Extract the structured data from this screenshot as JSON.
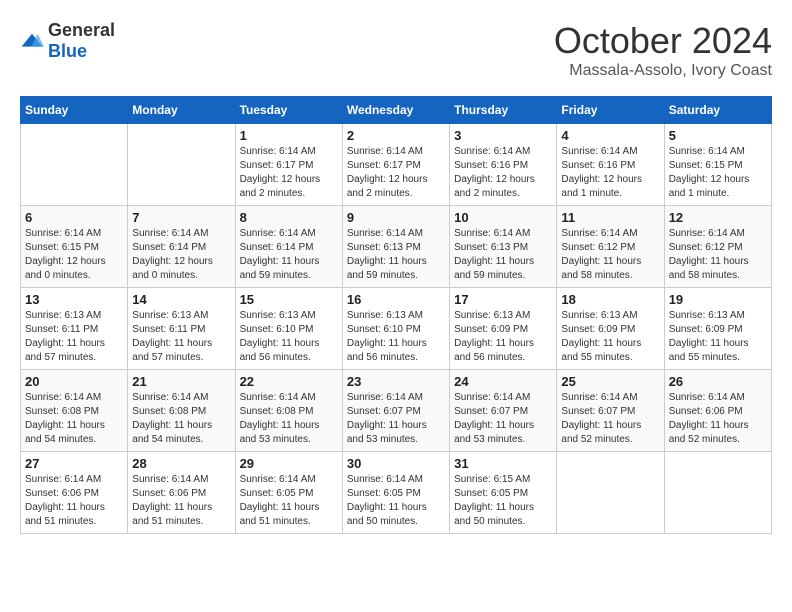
{
  "header": {
    "logo_general": "General",
    "logo_blue": "Blue",
    "month_title": "October 2024",
    "location": "Massala-Assolo, Ivory Coast"
  },
  "days_of_week": [
    "Sunday",
    "Monday",
    "Tuesday",
    "Wednesday",
    "Thursday",
    "Friday",
    "Saturday"
  ],
  "weeks": [
    [
      {
        "day": "",
        "info": ""
      },
      {
        "day": "",
        "info": ""
      },
      {
        "day": "1",
        "info": "Sunrise: 6:14 AM\nSunset: 6:17 PM\nDaylight: 12 hours\nand 2 minutes."
      },
      {
        "day": "2",
        "info": "Sunrise: 6:14 AM\nSunset: 6:17 PM\nDaylight: 12 hours\nand 2 minutes."
      },
      {
        "day": "3",
        "info": "Sunrise: 6:14 AM\nSunset: 6:16 PM\nDaylight: 12 hours\nand 2 minutes."
      },
      {
        "day": "4",
        "info": "Sunrise: 6:14 AM\nSunset: 6:16 PM\nDaylight: 12 hours\nand 1 minute."
      },
      {
        "day": "5",
        "info": "Sunrise: 6:14 AM\nSunset: 6:15 PM\nDaylight: 12 hours\nand 1 minute."
      }
    ],
    [
      {
        "day": "6",
        "info": "Sunrise: 6:14 AM\nSunset: 6:15 PM\nDaylight: 12 hours\nand 0 minutes."
      },
      {
        "day": "7",
        "info": "Sunrise: 6:14 AM\nSunset: 6:14 PM\nDaylight: 12 hours\nand 0 minutes."
      },
      {
        "day": "8",
        "info": "Sunrise: 6:14 AM\nSunset: 6:14 PM\nDaylight: 11 hours\nand 59 minutes."
      },
      {
        "day": "9",
        "info": "Sunrise: 6:14 AM\nSunset: 6:13 PM\nDaylight: 11 hours\nand 59 minutes."
      },
      {
        "day": "10",
        "info": "Sunrise: 6:14 AM\nSunset: 6:13 PM\nDaylight: 11 hours\nand 59 minutes."
      },
      {
        "day": "11",
        "info": "Sunrise: 6:14 AM\nSunset: 6:12 PM\nDaylight: 11 hours\nand 58 minutes."
      },
      {
        "day": "12",
        "info": "Sunrise: 6:14 AM\nSunset: 6:12 PM\nDaylight: 11 hours\nand 58 minutes."
      }
    ],
    [
      {
        "day": "13",
        "info": "Sunrise: 6:13 AM\nSunset: 6:11 PM\nDaylight: 11 hours\nand 57 minutes."
      },
      {
        "day": "14",
        "info": "Sunrise: 6:13 AM\nSunset: 6:11 PM\nDaylight: 11 hours\nand 57 minutes."
      },
      {
        "day": "15",
        "info": "Sunrise: 6:13 AM\nSunset: 6:10 PM\nDaylight: 11 hours\nand 56 minutes."
      },
      {
        "day": "16",
        "info": "Sunrise: 6:13 AM\nSunset: 6:10 PM\nDaylight: 11 hours\nand 56 minutes."
      },
      {
        "day": "17",
        "info": "Sunrise: 6:13 AM\nSunset: 6:09 PM\nDaylight: 11 hours\nand 56 minutes."
      },
      {
        "day": "18",
        "info": "Sunrise: 6:13 AM\nSunset: 6:09 PM\nDaylight: 11 hours\nand 55 minutes."
      },
      {
        "day": "19",
        "info": "Sunrise: 6:13 AM\nSunset: 6:09 PM\nDaylight: 11 hours\nand 55 minutes."
      }
    ],
    [
      {
        "day": "20",
        "info": "Sunrise: 6:14 AM\nSunset: 6:08 PM\nDaylight: 11 hours\nand 54 minutes."
      },
      {
        "day": "21",
        "info": "Sunrise: 6:14 AM\nSunset: 6:08 PM\nDaylight: 11 hours\nand 54 minutes."
      },
      {
        "day": "22",
        "info": "Sunrise: 6:14 AM\nSunset: 6:08 PM\nDaylight: 11 hours\nand 53 minutes."
      },
      {
        "day": "23",
        "info": "Sunrise: 6:14 AM\nSunset: 6:07 PM\nDaylight: 11 hours\nand 53 minutes."
      },
      {
        "day": "24",
        "info": "Sunrise: 6:14 AM\nSunset: 6:07 PM\nDaylight: 11 hours\nand 53 minutes."
      },
      {
        "day": "25",
        "info": "Sunrise: 6:14 AM\nSunset: 6:07 PM\nDaylight: 11 hours\nand 52 minutes."
      },
      {
        "day": "26",
        "info": "Sunrise: 6:14 AM\nSunset: 6:06 PM\nDaylight: 11 hours\nand 52 minutes."
      }
    ],
    [
      {
        "day": "27",
        "info": "Sunrise: 6:14 AM\nSunset: 6:06 PM\nDaylight: 11 hours\nand 51 minutes."
      },
      {
        "day": "28",
        "info": "Sunrise: 6:14 AM\nSunset: 6:06 PM\nDaylight: 11 hours\nand 51 minutes."
      },
      {
        "day": "29",
        "info": "Sunrise: 6:14 AM\nSunset: 6:05 PM\nDaylight: 11 hours\nand 51 minutes."
      },
      {
        "day": "30",
        "info": "Sunrise: 6:14 AM\nSunset: 6:05 PM\nDaylight: 11 hours\nand 50 minutes."
      },
      {
        "day": "31",
        "info": "Sunrise: 6:15 AM\nSunset: 6:05 PM\nDaylight: 11 hours\nand 50 minutes."
      },
      {
        "day": "",
        "info": ""
      },
      {
        "day": "",
        "info": ""
      }
    ]
  ]
}
